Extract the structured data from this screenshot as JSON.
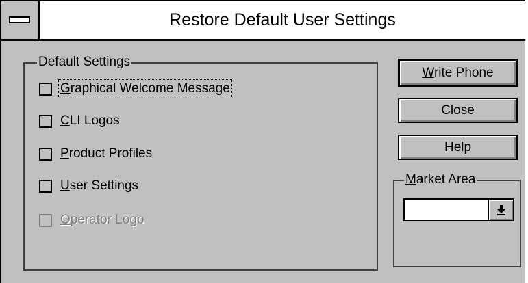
{
  "window": {
    "title": "Restore Default User Settings"
  },
  "default_settings": {
    "group_label": "Default Settings",
    "options": [
      {
        "mnemonic": "G",
        "rest": "raphical Welcome Message",
        "checked": false,
        "enabled": true,
        "focused": true
      },
      {
        "mnemonic": "C",
        "rest": "LI Logos",
        "checked": false,
        "enabled": true,
        "focused": false
      },
      {
        "mnemonic": "P",
        "rest": "roduct Profiles",
        "checked": false,
        "enabled": true,
        "focused": false
      },
      {
        "mnemonic": "U",
        "rest": "ser Settings",
        "checked": false,
        "enabled": true,
        "focused": false
      },
      {
        "mnemonic": "O",
        "rest": "perator Logo",
        "checked": false,
        "enabled": false,
        "focused": false
      }
    ]
  },
  "buttons": {
    "write_phone": {
      "mnemonic": "W",
      "rest": "rite Phone"
    },
    "close": {
      "label": "Close"
    },
    "help": {
      "mnemonic": "H",
      "rest": "elp"
    }
  },
  "market_area": {
    "mnemonic": "M",
    "rest": "arket Area",
    "selected_value": ""
  },
  "icons": {
    "system_menu": "system-menu-icon",
    "dropdown": "dropdown-arrow-icon"
  },
  "colors": {
    "face": "#c0c0c0",
    "title_bg": "#ffffff",
    "disabled_text": "#808080"
  }
}
